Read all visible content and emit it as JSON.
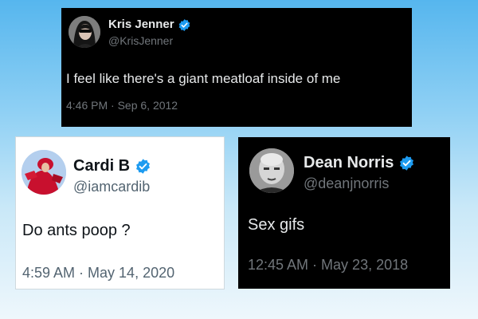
{
  "tweets": [
    {
      "name": "Kris Jenner",
      "handle": "@KrisJenner",
      "text": "I feel like there's a giant meatloaf inside of me",
      "timestamp": "4:46 PM · Sep 6, 2012",
      "theme": "dark",
      "verified": true
    },
    {
      "name": "Cardi B",
      "handle": "@iamcardib",
      "text": "Do ants poop ?",
      "timestamp": "4:59 AM · May 14, 2020",
      "theme": "light",
      "verified": true
    },
    {
      "name": "Dean Norris",
      "handle": "@deanjnorris",
      "text": "Sex gifs",
      "timestamp": "12:45 AM · May 23, 2018",
      "theme": "dark",
      "verified": true
    }
  ],
  "colors": {
    "verified_badge": "#1d9bf0",
    "background_top": "#56b6ee",
    "background_bottom": "#eef7fc"
  },
  "icons": {
    "verified": "verified-badge-icon"
  }
}
